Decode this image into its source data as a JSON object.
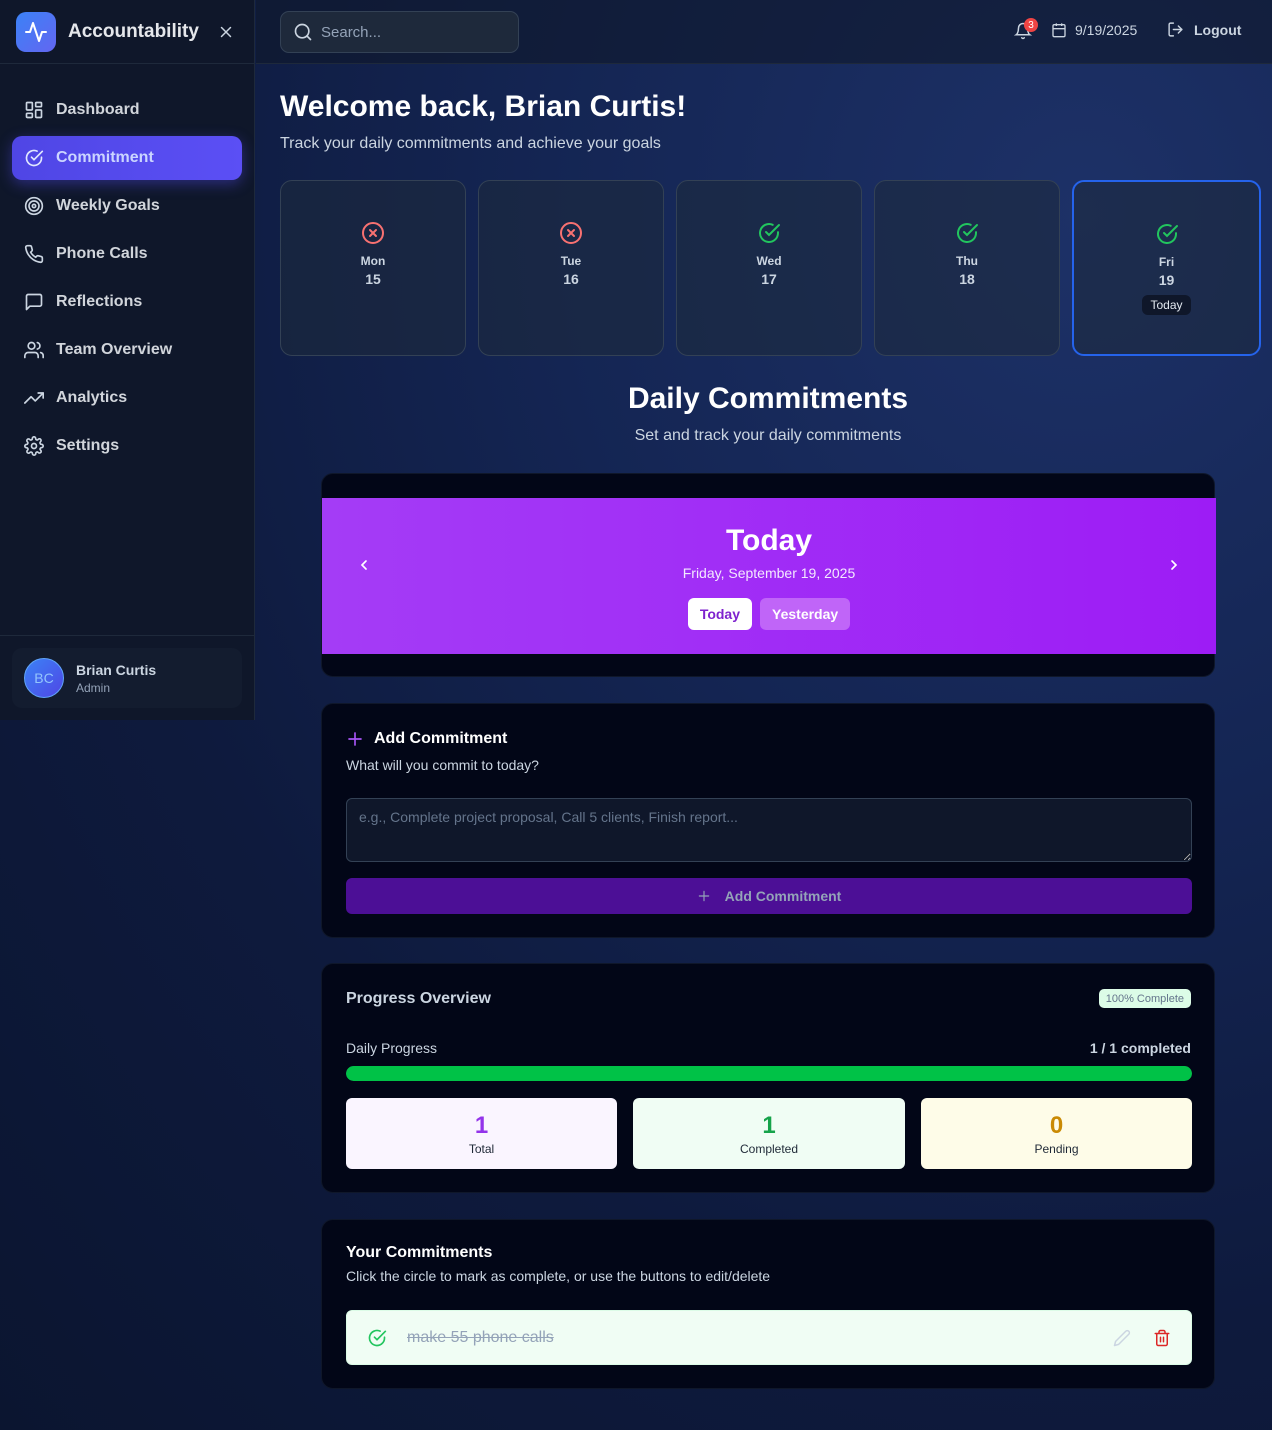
{
  "app": {
    "name": "Accountability"
  },
  "sidebar": {
    "items": [
      {
        "label": "Dashboard",
        "icon": "dashboard-icon"
      },
      {
        "label": "Commitment",
        "icon": "check-circle-icon",
        "active": true
      },
      {
        "label": "Weekly Goals",
        "icon": "target-icon"
      },
      {
        "label": "Phone Calls",
        "icon": "phone-icon"
      },
      {
        "label": "Reflections",
        "icon": "message-square-icon"
      },
      {
        "label": "Team Overview",
        "icon": "users-icon"
      },
      {
        "label": "Analytics",
        "icon": "trending-up-icon"
      },
      {
        "label": "Settings",
        "icon": "gear-icon"
      }
    ],
    "user": {
      "initials": "BC",
      "name": "Brian Curtis",
      "role": "Admin"
    }
  },
  "topbar": {
    "search_placeholder": "Search...",
    "notification_count": "3",
    "date": "9/19/2025",
    "logout_label": "Logout"
  },
  "welcome": {
    "title": "Welcome back, Brian Curtis!",
    "subtitle": "Track your daily commitments and achieve your goals"
  },
  "week": [
    {
      "day": "Mon",
      "date": "15",
      "status": "missed"
    },
    {
      "day": "Tue",
      "date": "16",
      "status": "missed"
    },
    {
      "day": "Wed",
      "date": "17",
      "status": "done"
    },
    {
      "day": "Thu",
      "date": "18",
      "status": "done"
    },
    {
      "day": "Fri",
      "date": "19",
      "status": "done",
      "today_label": "Today"
    }
  ],
  "daily": {
    "title": "Daily Commitments",
    "subtitle": "Set and track your daily commitments",
    "banner_title": "Today",
    "banner_date": "Friday, September 19, 2025",
    "btn_today": "Today",
    "btn_yesterday": "Yesterday"
  },
  "add": {
    "title": "Add Commitment",
    "subtitle": "What will you commit to today?",
    "placeholder": "e.g., Complete project proposal, Call 5 clients, Finish report...",
    "button_label": "Add Commitment"
  },
  "progress": {
    "title": "Progress Overview",
    "badge": "100% Complete",
    "label": "Daily Progress",
    "count": "1 / 1 completed",
    "fraction": 1.0,
    "stats": [
      {
        "value": "1",
        "label": "Total",
        "color": "#9333ea",
        "bg": "#faf5ff"
      },
      {
        "value": "1",
        "label": "Completed",
        "color": "#16a34a",
        "bg": "#f0fdf4"
      },
      {
        "value": "0",
        "label": "Pending",
        "color": "#ca8a04",
        "bg": "#fefce8"
      }
    ]
  },
  "commitments": {
    "title": "Your Commitments",
    "subtitle": "Click the circle to mark as complete, or use the buttons to edit/delete",
    "items": [
      {
        "text": "make 55 phone calls",
        "completed": true
      }
    ]
  },
  "colors": {
    "accent": "#4f46e5",
    "banner": "#a43cf6",
    "success": "#00c247",
    "danger": "#ef4444"
  }
}
